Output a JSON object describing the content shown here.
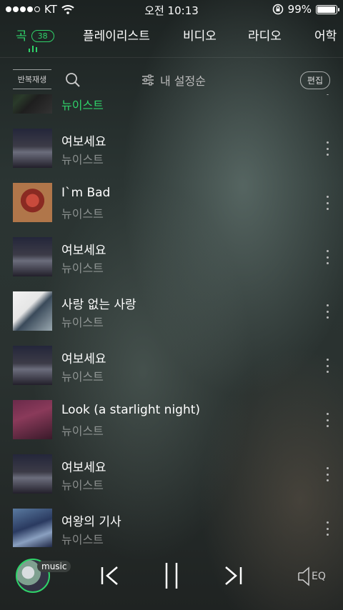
{
  "status_bar": {
    "carrier": "KT",
    "time": "오전 10:13",
    "battery": "99%"
  },
  "tabs": [
    {
      "label": "곡",
      "count": "38",
      "active": true
    },
    {
      "label": "플레이리스트"
    },
    {
      "label": "비디오"
    },
    {
      "label": "라디오"
    },
    {
      "label": "어학"
    }
  ],
  "toolbar": {
    "repeat_label": "반복재생",
    "sort_label": "내 설정순",
    "edit_label": "편집"
  },
  "songs": [
    {
      "title": "",
      "artist": "뉴이스트",
      "current": true
    },
    {
      "title": "여보세요",
      "artist": "뉴이스트"
    },
    {
      "title": "I`m Bad",
      "artist": "뉴이스트"
    },
    {
      "title": "여보세요",
      "artist": "뉴이스트"
    },
    {
      "title": "사랑 없는 사랑",
      "artist": "뉴이스트"
    },
    {
      "title": "여보세요",
      "artist": "뉴이스트"
    },
    {
      "title": "Look (a starlight night)",
      "artist": "뉴이스트"
    },
    {
      "title": "여보세요",
      "artist": "뉴이스트"
    },
    {
      "title": "여왕의 기사",
      "artist": "뉴이스트"
    }
  ],
  "player": {
    "music_label": "music",
    "eq_label": "EQ"
  },
  "colors": {
    "accent": "#2fd36a"
  }
}
